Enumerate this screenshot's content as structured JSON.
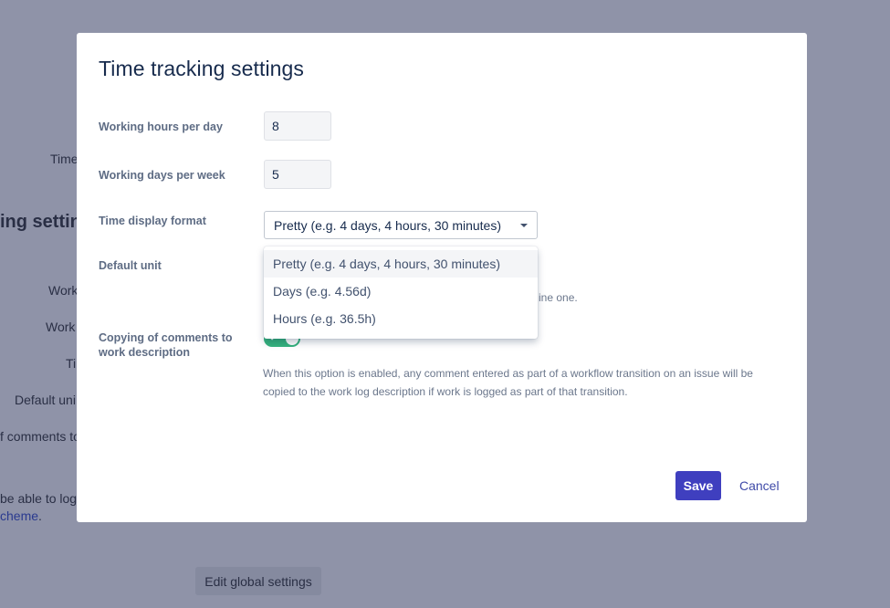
{
  "background": {
    "time_label": "Time",
    "heading_fragment": "ing setting",
    "row_labels": [
      "Work",
      "Work",
      "Ti",
      "Default uni",
      "f comments to"
    ],
    "note_fragment": " be able to log",
    "scheme_link": "cheme",
    "scheme_period": ".",
    "edit_global_button": "Edit global settings"
  },
  "modal": {
    "title": "Time tracking settings",
    "fields": {
      "hours_per_day": {
        "label": "Working hours per day",
        "value": "8"
      },
      "days_per_week": {
        "label": "Working days per week",
        "value": "5"
      },
      "display_format": {
        "label": "Time display format",
        "selected": "Pretty (e.g. 4 days, 4 hours, 30 minutes)",
        "options": [
          "Pretty (e.g. 4 days, 4 hours, 30 minutes)",
          "Days (e.g. 4.56d)",
          "Hours (e.g. 36.5h)"
        ]
      },
      "default_unit": {
        "label": "Default unit",
        "hint_fragment": "ine one."
      },
      "copy_comments": {
        "label": "Copying of comments to work description",
        "enabled": true,
        "hint": "When this option is enabled, any comment entered as part of a workflow transition on an issue will be copied to the work log description if work is logged as part of that transition."
      }
    },
    "save_label": "Save",
    "cancel_label": "Cancel"
  },
  "colors": {
    "overlay": "#8f93a8",
    "primary_button": "#3f3fbf",
    "toggle_on": "#36b37e"
  }
}
